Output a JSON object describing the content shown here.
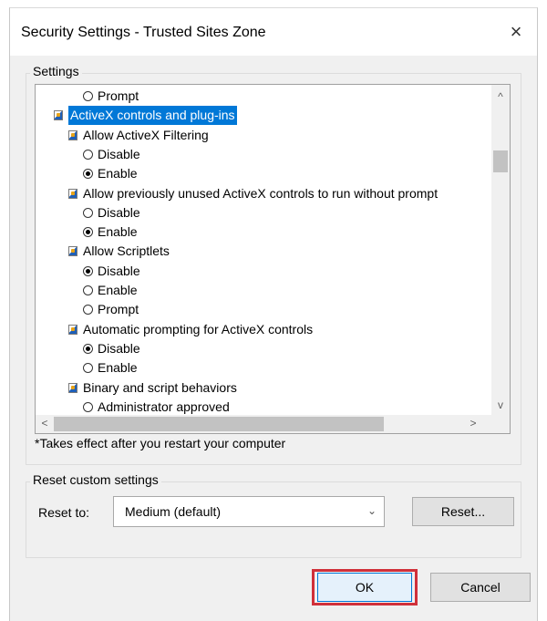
{
  "window": {
    "title": "Security Settings - Trusted Sites Zone",
    "close_glyph": "×"
  },
  "settings": {
    "group_label": "Settings",
    "rows": [
      {
        "kind": "radio",
        "label": "Prompt",
        "checked": false,
        "indent": 1
      },
      {
        "kind": "category",
        "label": "ActiveX controls and plug-ins",
        "selected": true,
        "indent": 0
      },
      {
        "kind": "setting",
        "label": "Allow ActiveX Filtering",
        "indent": 1
      },
      {
        "kind": "radio",
        "label": "Disable",
        "checked": false,
        "indent": 1
      },
      {
        "kind": "radio",
        "label": "Enable",
        "checked": true,
        "indent": 1
      },
      {
        "kind": "setting",
        "label": "Allow previously unused ActiveX controls to run without prompt",
        "indent": 1
      },
      {
        "kind": "radio",
        "label": "Disable",
        "checked": false,
        "indent": 1
      },
      {
        "kind": "radio",
        "label": "Enable",
        "checked": true,
        "indent": 1
      },
      {
        "kind": "setting",
        "label": "Allow Scriptlets",
        "indent": 1
      },
      {
        "kind": "radio",
        "label": "Disable",
        "checked": true,
        "indent": 1
      },
      {
        "kind": "radio",
        "label": "Enable",
        "checked": false,
        "indent": 1
      },
      {
        "kind": "radio",
        "label": "Prompt",
        "checked": false,
        "indent": 1
      },
      {
        "kind": "setting",
        "label": "Automatic prompting for ActiveX controls",
        "indent": 1
      },
      {
        "kind": "radio",
        "label": "Disable",
        "checked": true,
        "indent": 1
      },
      {
        "kind": "radio",
        "label": "Enable",
        "checked": false,
        "indent": 1
      },
      {
        "kind": "setting",
        "label": "Binary and script behaviors",
        "indent": 1
      },
      {
        "kind": "radio",
        "label": "Administrator approved",
        "checked": false,
        "indent": 1
      }
    ],
    "scroll_up": "^",
    "scroll_down": "v",
    "scroll_left": "<",
    "scroll_right": ">",
    "note": "*Takes effect after you restart your computer"
  },
  "reset": {
    "group_label": "Reset custom settings",
    "reset_to_label": "Reset to:",
    "selected_level": "Medium (default)",
    "reset_button": "Reset..."
  },
  "footer": {
    "ok": "OK",
    "cancel": "Cancel"
  },
  "colors": {
    "selection": "#0078d7",
    "highlight_box": "#d0303a"
  }
}
